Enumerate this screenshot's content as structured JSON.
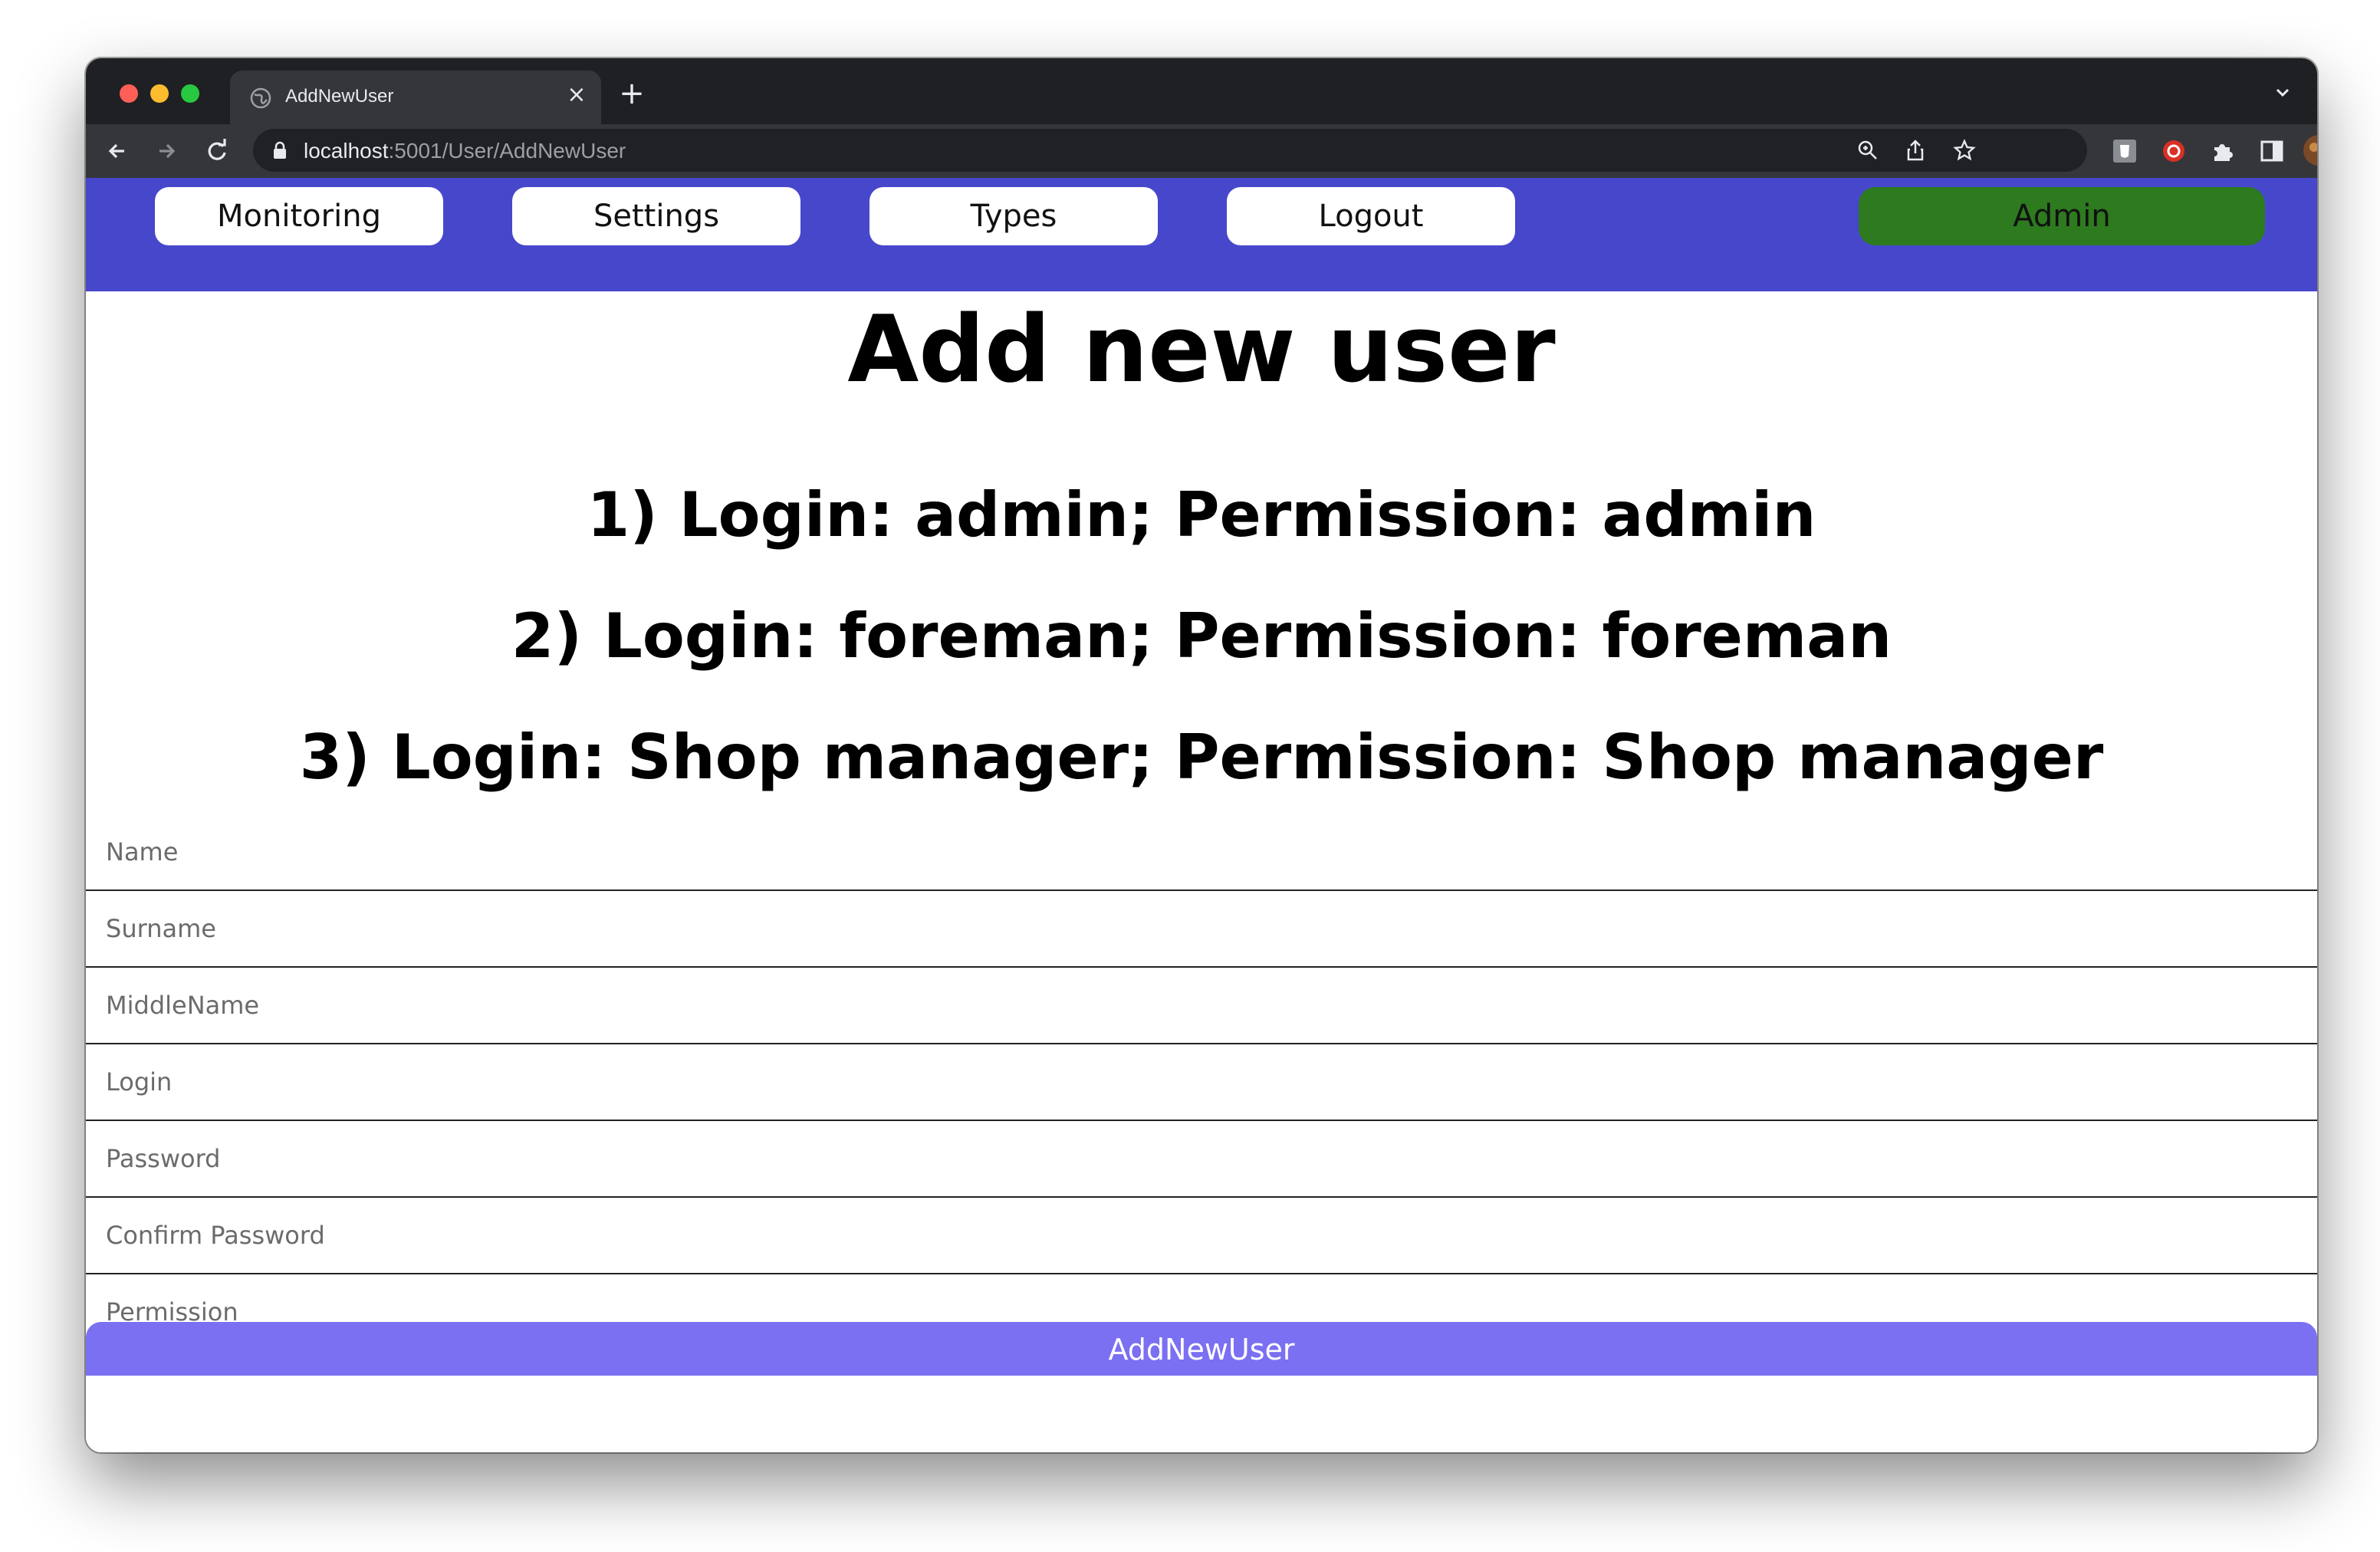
{
  "browser": {
    "tab_title": "AddNewUser",
    "url_host": "localhost",
    "url_rest": ":5001/User/AddNewUser"
  },
  "navbar": {
    "items": [
      {
        "label": "Monitoring"
      },
      {
        "label": "Settings"
      },
      {
        "label": "Types"
      },
      {
        "label": "Logout"
      }
    ],
    "user_label": "Admin",
    "colors": {
      "bar": "#4747cc",
      "user": "#2d7a1f"
    }
  },
  "main": {
    "title": "Add new user",
    "roles": [
      "1) Login: admin; Permission: admin",
      "2) Login: foreman; Permission: foreman",
      "3) Login: Shop manager; Permission: Shop manager"
    ]
  },
  "form": {
    "fields": [
      {
        "placeholder": "Name",
        "value": ""
      },
      {
        "placeholder": "Surname",
        "value": ""
      },
      {
        "placeholder": "MiddleName",
        "value": ""
      },
      {
        "placeholder": "Login",
        "value": ""
      },
      {
        "placeholder": "Password",
        "value": ""
      },
      {
        "placeholder": "Confirm Password",
        "value": ""
      },
      {
        "placeholder": "Permission",
        "value": ""
      }
    ],
    "submit_label": "AddNewUser",
    "submit_color": "#7b6ff2"
  }
}
